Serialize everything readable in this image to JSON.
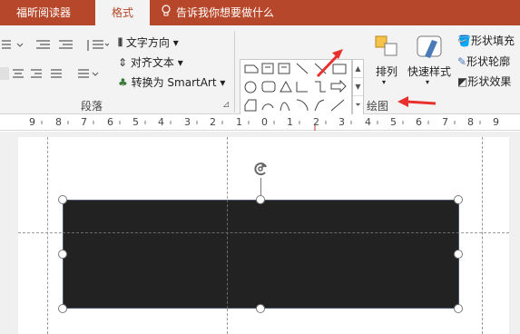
{
  "tabs": {
    "foxit": "福昕阅读器",
    "format": "格式",
    "tell_me": "告诉我你想要做什么"
  },
  "ribbon": {
    "paragraph_group": "段落",
    "drawing_group": "绘图",
    "text_direction": "文字方向",
    "align_text": "对齐文本",
    "convert_smartart": "转换为 SmartArt",
    "arrange": "排列",
    "quick_styles": "快速样式",
    "shape_fill": "形状填充",
    "shape_outline": "形状轮廓",
    "shape_effects": "形状效果"
  },
  "ruler": {
    "labels": [
      "9",
      "8",
      "7",
      "6",
      "5",
      "4",
      "3",
      "2",
      "1",
      "0",
      "1",
      "2",
      "3",
      "4",
      "5",
      "6",
      "7",
      "8",
      "9"
    ]
  },
  "colors": {
    "accent": "#b7472a",
    "shape_fill": "#222222",
    "annotation_arrow": "#e8312e"
  },
  "icons": [
    "lightbulb-icon",
    "text-direction-icon",
    "align-text-icon",
    "smartart-icon",
    "arrange-icon",
    "quick-styles-icon",
    "shape-fill-icon",
    "shape-outline-icon",
    "shape-effects-icon",
    "dialog-launcher-icon",
    "rotate-handle-icon"
  ]
}
